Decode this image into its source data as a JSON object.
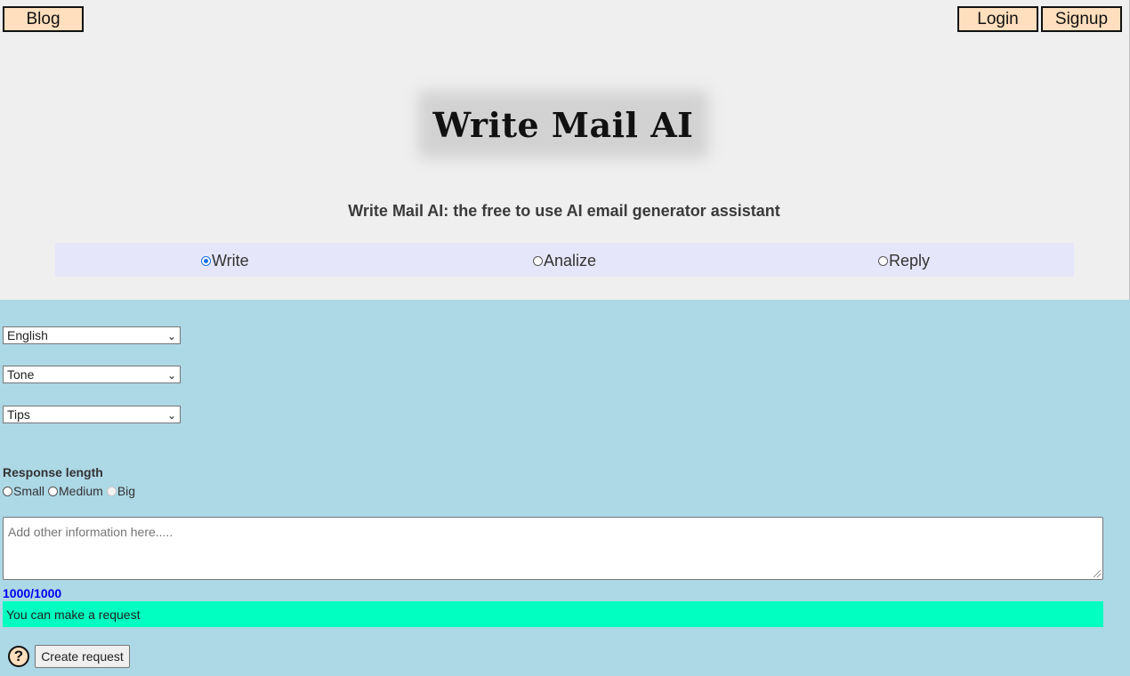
{
  "nav": {
    "blog_label": "Blog",
    "login_label": "Login",
    "signup_label": "Signup"
  },
  "header": {
    "logo_text": "Write Mail AI",
    "subtitle": "Write Mail AI: the free to use AI email generator assistant"
  },
  "modes": {
    "selected": "Write",
    "items": [
      {
        "label": "Write",
        "checked": true
      },
      {
        "label": "Analize",
        "checked": false
      },
      {
        "label": "Reply",
        "checked": false
      }
    ]
  },
  "form": {
    "language_select": "English",
    "tone_select": "Tone",
    "tips_select": "Tips",
    "response_length_label": "Response length",
    "response_length_options": [
      {
        "label": "Small",
        "disabled": false
      },
      {
        "label": "Medium",
        "disabled": false
      },
      {
        "label": "Big",
        "disabled": true
      }
    ],
    "textarea_placeholder": "Add other information here.....",
    "char_counter": "1000/1000",
    "status_message": "You can make a request",
    "help_icon_glyph": "?",
    "create_button_label": "Create request"
  },
  "colors": {
    "nav_button_bg": "#ffdfbd",
    "top_bg": "#efefef",
    "mode_bar_bg": "#e6e6fa",
    "bottom_bg": "#add8e6",
    "status_bg": "#00ffc0",
    "counter_text": "#0000ee"
  }
}
